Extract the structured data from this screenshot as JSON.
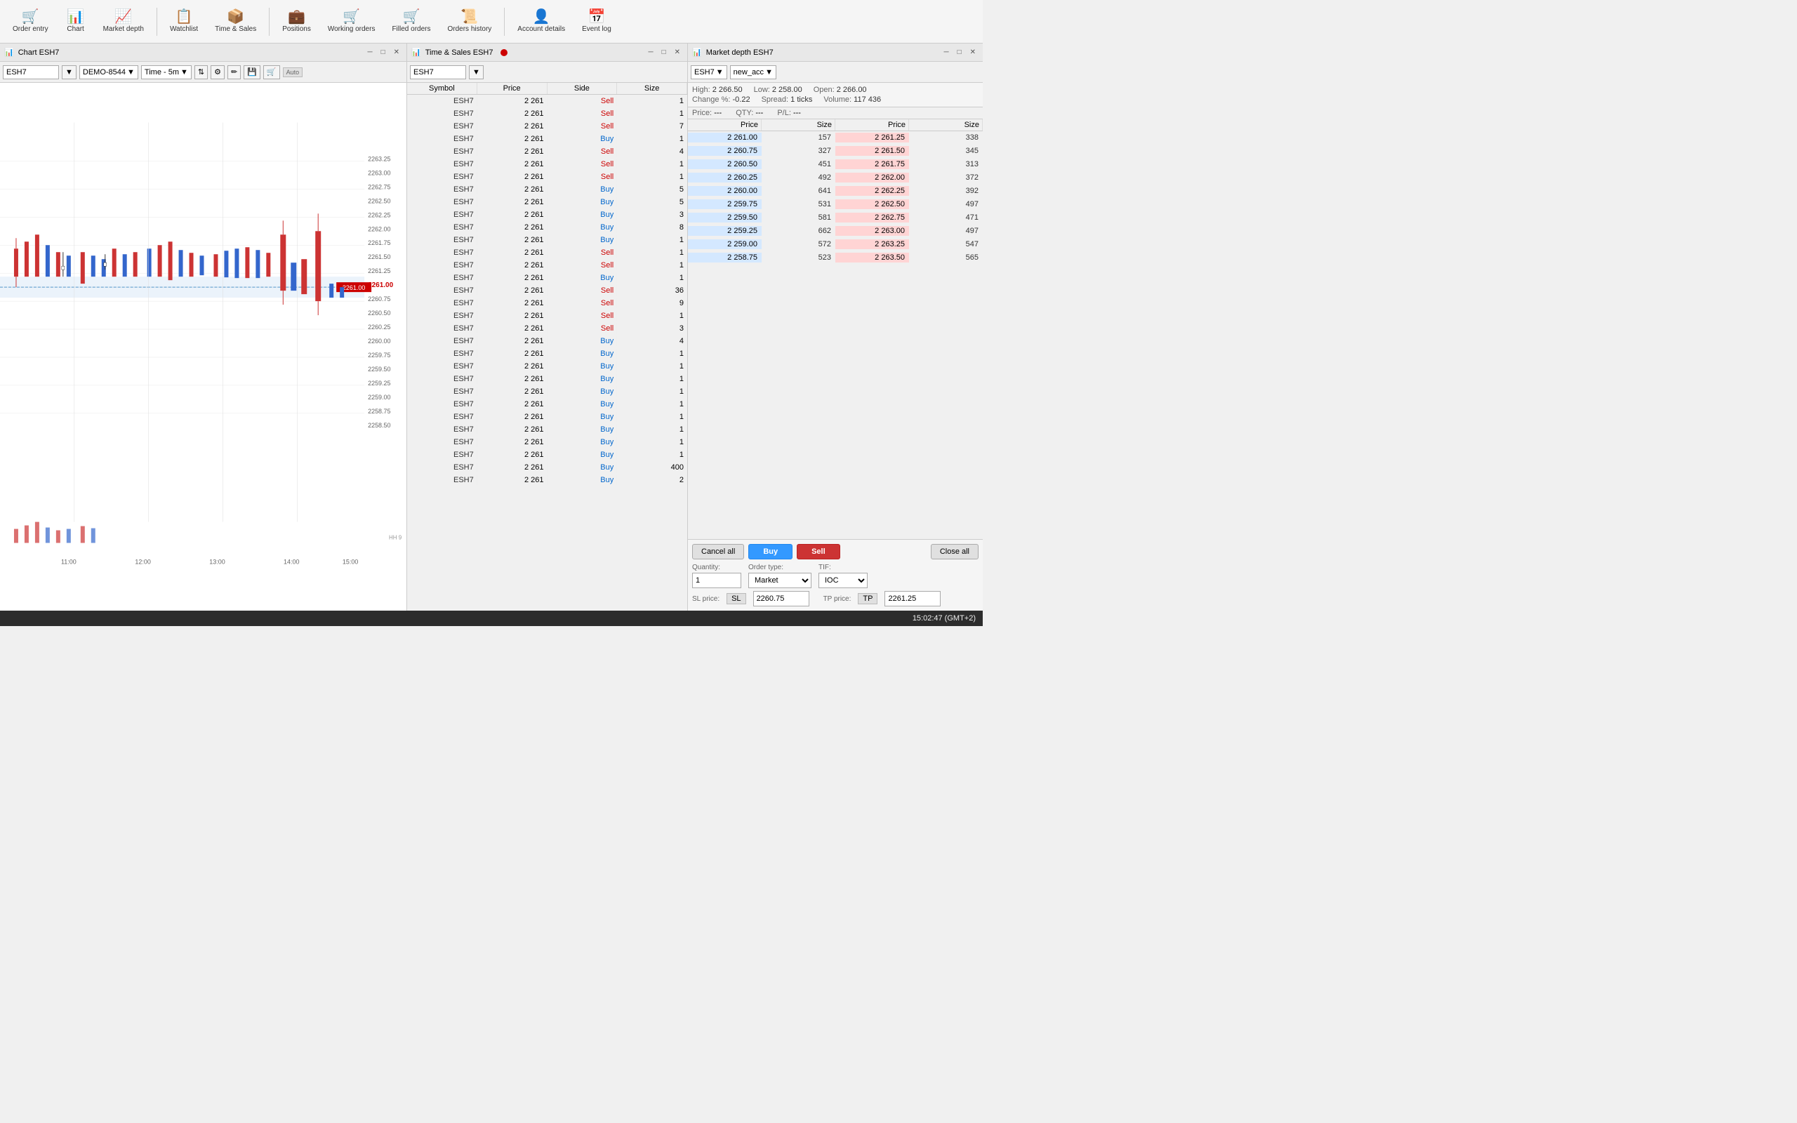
{
  "toolbar": {
    "items": [
      {
        "id": "order-entry",
        "label": "Order entry",
        "icon": "🛒"
      },
      {
        "id": "chart",
        "label": "Chart",
        "icon": "📊"
      },
      {
        "id": "market-depth",
        "label": "Market depth",
        "icon": "📈"
      },
      {
        "id": "watchlist",
        "label": "Watchlist",
        "icon": "📋"
      },
      {
        "id": "time-sales",
        "label": "Time & Sales",
        "icon": "📦"
      },
      {
        "id": "positions",
        "label": "Positions",
        "icon": "💼"
      },
      {
        "id": "working-orders",
        "label": "Working orders",
        "icon": "🛒"
      },
      {
        "id": "filled-orders",
        "label": "Filled orders",
        "icon": "🛒"
      },
      {
        "id": "orders-history",
        "label": "Orders history",
        "icon": "📜"
      },
      {
        "id": "account-details",
        "label": "Account details",
        "icon": "👤"
      },
      {
        "id": "event-log",
        "label": "Event log",
        "icon": "📅"
      }
    ]
  },
  "chart": {
    "panel_title": "Chart ESH7",
    "symbol": "ESH7",
    "account": "DEMO-8544",
    "timeframe": "Time - 5m",
    "current_price": "2261.00",
    "prices": [
      2258.5,
      2259.0,
      2259.25,
      2259.5,
      2259.75,
      2260.0,
      2260.25,
      2260.5,
      2260.75,
      2261.0,
      2261.25,
      2261.5,
      2261.75,
      2262.0,
      2262.25,
      2262.5,
      2262.75,
      2263.0,
      2263.25
    ],
    "x_labels": [
      "11:00",
      "12:00",
      "13:00",
      "14:00",
      "15:00"
    ]
  },
  "time_sales": {
    "panel_title": "Time & Sales ESH7",
    "symbol_input": "ESH7",
    "columns": [
      "Symbol",
      "Price",
      "Side",
      "Size"
    ],
    "rows": [
      {
        "symbol": "ESH7",
        "price": "2 261",
        "side": "Sell",
        "side_class": "sell",
        "size": "1"
      },
      {
        "symbol": "ESH7",
        "price": "2 261",
        "side": "Sell",
        "side_class": "sell",
        "size": "1"
      },
      {
        "symbol": "ESH7",
        "price": "2 261",
        "side": "Sell",
        "side_class": "sell",
        "size": "7"
      },
      {
        "symbol": "ESH7",
        "price": "2 261",
        "side": "Buy",
        "side_class": "buy",
        "size": "1"
      },
      {
        "symbol": "ESH7",
        "price": "2 261",
        "side": "Sell",
        "side_class": "sell",
        "size": "4"
      },
      {
        "symbol": "ESH7",
        "price": "2 261",
        "side": "Sell",
        "side_class": "sell",
        "size": "1"
      },
      {
        "symbol": "ESH7",
        "price": "2 261",
        "side": "Sell",
        "side_class": "sell",
        "size": "1"
      },
      {
        "symbol": "ESH7",
        "price": "2 261",
        "side": "Buy",
        "side_class": "buy",
        "size": "5"
      },
      {
        "symbol": "ESH7",
        "price": "2 261",
        "side": "Buy",
        "side_class": "buy",
        "size": "5"
      },
      {
        "symbol": "ESH7",
        "price": "2 261",
        "side": "Buy",
        "side_class": "buy",
        "size": "3"
      },
      {
        "symbol": "ESH7",
        "price": "2 261",
        "side": "Buy",
        "side_class": "buy",
        "size": "8"
      },
      {
        "symbol": "ESH7",
        "price": "2 261",
        "side": "Buy",
        "side_class": "buy",
        "size": "1"
      },
      {
        "symbol": "ESH7",
        "price": "2 261",
        "side": "Sell",
        "side_class": "sell",
        "size": "1"
      },
      {
        "symbol": "ESH7",
        "price": "2 261",
        "side": "Sell",
        "side_class": "sell",
        "size": "1"
      },
      {
        "symbol": "ESH7",
        "price": "2 261",
        "side": "Buy",
        "side_class": "buy",
        "size": "1"
      },
      {
        "symbol": "ESH7",
        "price": "2 261",
        "side": "Sell",
        "side_class": "sell",
        "size": "36"
      },
      {
        "symbol": "ESH7",
        "price": "2 261",
        "side": "Sell",
        "side_class": "sell",
        "size": "9"
      },
      {
        "symbol": "ESH7",
        "price": "2 261",
        "side": "Sell",
        "side_class": "sell",
        "size": "1"
      },
      {
        "symbol": "ESH7",
        "price": "2 261",
        "side": "Sell",
        "side_class": "sell",
        "size": "3"
      },
      {
        "symbol": "ESH7",
        "price": "2 261",
        "side": "Buy",
        "side_class": "buy",
        "size": "4"
      },
      {
        "symbol": "ESH7",
        "price": "2 261",
        "side": "Buy",
        "side_class": "buy",
        "size": "1"
      },
      {
        "symbol": "ESH7",
        "price": "2 261",
        "side": "Buy",
        "side_class": "buy",
        "size": "1"
      },
      {
        "symbol": "ESH7",
        "price": "2 261",
        "side": "Buy",
        "side_class": "buy",
        "size": "1"
      },
      {
        "symbol": "ESH7",
        "price": "2 261",
        "side": "Buy",
        "side_class": "buy",
        "size": "1"
      },
      {
        "symbol": "ESH7",
        "price": "2 261",
        "side": "Buy",
        "side_class": "buy",
        "size": "1"
      },
      {
        "symbol": "ESH7",
        "price": "2 261",
        "side": "Buy",
        "side_class": "buy",
        "size": "1"
      },
      {
        "symbol": "ESH7",
        "price": "2 261",
        "side": "Buy",
        "side_class": "buy",
        "size": "1"
      },
      {
        "symbol": "ESH7",
        "price": "2 261",
        "side": "Buy",
        "side_class": "buy",
        "size": "1"
      },
      {
        "symbol": "ESH7",
        "price": "2 261",
        "side": "Buy",
        "side_class": "buy",
        "size": "1"
      },
      {
        "symbol": "ESH7",
        "price": "2 261",
        "side": "Buy",
        "side_class": "buy",
        "size": "400"
      },
      {
        "symbol": "ESH7",
        "price": "2 261",
        "side": "Buy",
        "side_class": "buy",
        "size": "2"
      }
    ]
  },
  "market_depth": {
    "panel_title": "Market depth ESH7",
    "symbol": "ESH7",
    "account": "new_acc",
    "high": "2 266.50",
    "low": "2 258.00",
    "open": "2 266.00",
    "change_pct": "-0.22",
    "spread": "1 ticks",
    "volume": "117 436",
    "price_label": "Price:",
    "price_value": "---",
    "qty_label": "QTY:",
    "qty_value": "---",
    "pl_label": "P/L:",
    "pl_value": "---",
    "columns": [
      "Price",
      "Size",
      "Price",
      "Size"
    ],
    "rows": [
      {
        "bid_price": "2 261.00",
        "bid_size": "157",
        "ask_price": "2 261.25",
        "ask_size": "338"
      },
      {
        "bid_price": "2 260.75",
        "bid_size": "327",
        "ask_price": "2 261.50",
        "ask_size": "345"
      },
      {
        "bid_price": "2 260.50",
        "bid_size": "451",
        "ask_price": "2 261.75",
        "ask_size": "313"
      },
      {
        "bid_price": "2 260.25",
        "bid_size": "492",
        "ask_price": "2 262.00",
        "ask_size": "372"
      },
      {
        "bid_price": "2 260.00",
        "bid_size": "641",
        "ask_price": "2 262.25",
        "ask_size": "392"
      },
      {
        "bid_price": "2 259.75",
        "bid_size": "531",
        "ask_price": "2 262.50",
        "ask_size": "497"
      },
      {
        "bid_price": "2 259.50",
        "bid_size": "581",
        "ask_price": "2 262.75",
        "ask_size": "471"
      },
      {
        "bid_price": "2 259.25",
        "bid_size": "662",
        "ask_price": "2 263.00",
        "ask_size": "497"
      },
      {
        "bid_price": "2 259.00",
        "bid_size": "572",
        "ask_price": "2 263.25",
        "ask_size": "547"
      },
      {
        "bid_price": "2 258.75",
        "bid_size": "523",
        "ask_price": "2 263.50",
        "ask_size": "565"
      }
    ]
  },
  "order_entry": {
    "cancel_all_label": "Cancel all",
    "buy_label": "Buy",
    "sell_label": "Sell",
    "close_all_label": "Close all",
    "quantity_label": "Quantity:",
    "quantity_value": "1",
    "order_type_label": "Order type:",
    "order_type_value": "Market",
    "tif_label": "TIF:",
    "tif_value": "IOC",
    "sl_price_label": "SL price:",
    "sl_badge": "SL",
    "sl_value": "2260.75",
    "tp_price_label": "TP price:",
    "tp_badge": "TP",
    "tp_value": "2261.25"
  },
  "status_bar": {
    "time": "15:02:47 (GMT+2)"
  }
}
